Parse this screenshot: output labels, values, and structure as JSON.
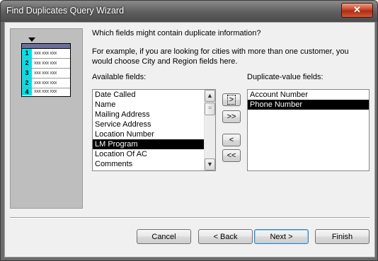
{
  "window": {
    "title": "Find Duplicates Query Wizard",
    "close_glyph": "✕"
  },
  "illustration": {
    "rows": [
      {
        "num": "1",
        "cells": "xxx xxx xxx"
      },
      {
        "num": "2",
        "cells": "xxx xxx xxx"
      },
      {
        "num": "3",
        "cells": "xxx xxx xxx"
      },
      {
        "num": "2",
        "cells": "xxx xxx xxx"
      },
      {
        "num": "4",
        "cells": "xxx xxx xxx"
      }
    ]
  },
  "question": "Which fields might contain duplicate information?",
  "example_line1": "For example, if you are looking for cities with more than one customer, you",
  "example_line2": "would choose City and Region fields here.",
  "available": {
    "label": "Available fields:",
    "items": [
      {
        "text": "Date Called"
      },
      {
        "text": "Name"
      },
      {
        "text": "Mailing Address"
      },
      {
        "text": "Service Address"
      },
      {
        "text": "Location Number"
      },
      {
        "text": "LM Program",
        "selected": true
      },
      {
        "text": "Location Of AC"
      },
      {
        "text": "Comments"
      }
    ],
    "scroll_up": "▲",
    "scroll_down": "▼",
    "thumb_grip": "≡"
  },
  "duplicate": {
    "label": "Duplicate-value fields:",
    "items": [
      {
        "text": "Account Number"
      },
      {
        "text": "Phone Number",
        "selected": true
      }
    ]
  },
  "move_buttons": {
    "add_one": ">",
    "add_all": ">>",
    "remove_one": "<",
    "remove_all": "<<"
  },
  "footer": {
    "cancel": "Cancel",
    "back": "< Back",
    "next": "Next >",
    "finish": "Finish"
  }
}
